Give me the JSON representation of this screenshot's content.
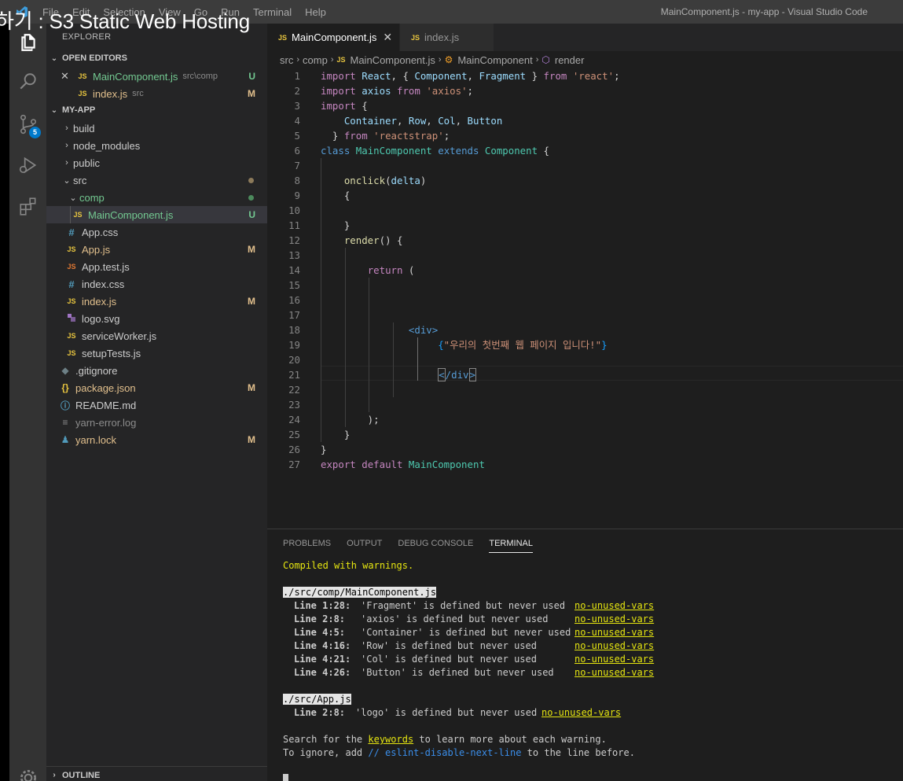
{
  "overlay_caption": "하기 : S3 Static Web Hosting",
  "titlebar": {
    "menu": [
      "File",
      "Edit",
      "Selection",
      "View",
      "Go",
      "Run",
      "Terminal",
      "Help"
    ],
    "window_title": "MainComponent.js - my-app - Visual Studio Code"
  },
  "activitybar": {
    "items": [
      "files-icon",
      "search-icon",
      "source-control-icon",
      "run-debug-icon",
      "extensions-icon",
      "accounts-icon"
    ],
    "source_control_badge": "5"
  },
  "sidebar": {
    "title": "EXPLORER",
    "open_editors_header": "OPEN EDITORS",
    "open_editors": [
      {
        "icon": "JS",
        "name": "MainComponent.js",
        "desc": "src\\comp",
        "status": "U"
      },
      {
        "icon": "JS",
        "name": "index.js",
        "desc": "src",
        "status": "M"
      }
    ],
    "project_header": "MY-APP",
    "tree": [
      {
        "name": "build",
        "type": "folder"
      },
      {
        "name": "node_modules",
        "type": "folder"
      },
      {
        "name": "public",
        "type": "folder"
      },
      {
        "name": "src",
        "type": "folder-open"
      },
      {
        "name": "comp",
        "type": "folder-open"
      },
      {
        "name": "MainComponent.js",
        "icon": "JS",
        "status": "U"
      },
      {
        "name": "App.css",
        "icon": "#"
      },
      {
        "name": "App.js",
        "icon": "JS",
        "status": "M"
      },
      {
        "name": "App.test.js",
        "icon": "JS"
      },
      {
        "name": "index.css",
        "icon": "#"
      },
      {
        "name": "index.js",
        "icon": "JS",
        "status": "M"
      },
      {
        "name": "logo.svg",
        "icon": "svg"
      },
      {
        "name": "serviceWorker.js",
        "icon": "JS"
      },
      {
        "name": "setupTests.js",
        "icon": "JS"
      },
      {
        "name": ".gitignore",
        "icon": "git"
      },
      {
        "name": "package.json",
        "icon": "{}",
        "status": "M"
      },
      {
        "name": "README.md",
        "icon": "i"
      },
      {
        "name": "yarn-error.log",
        "icon": "log"
      },
      {
        "name": "yarn.lock",
        "icon": "yarn",
        "status": "M"
      }
    ],
    "outline_header": "OUTLINE"
  },
  "tabs": [
    {
      "icon": "JS",
      "label": "MainComponent.js",
      "active": true
    },
    {
      "icon": "JS",
      "label": "index.js",
      "active": false
    }
  ],
  "breadcrumb": [
    "src",
    "comp",
    "MainComponent.js",
    "MainComponent",
    "render"
  ],
  "editor": {
    "line_numbers": [
      "1",
      "2",
      "3",
      "4",
      "5",
      "6",
      "7",
      "8",
      "9",
      "10",
      "11",
      "12",
      "13",
      "14",
      "15",
      "16",
      "17",
      "18",
      "19",
      "20",
      "21",
      "22",
      "23",
      "24",
      "25",
      "26",
      "27"
    ],
    "active_line": 21
  },
  "panel": {
    "tabs": [
      "PROBLEMS",
      "OUTPUT",
      "DEBUG CONSOLE",
      "TERMINAL"
    ],
    "active_tab": "TERMINAL",
    "compiled": "Compiled with warnings.",
    "file1": "./src/comp/MainComponent.js",
    "warnings1": [
      {
        "loc": "Line 1:28:",
        "msg": "'Fragment' is defined but never used",
        "rule": "no-unused-vars"
      },
      {
        "loc": "Line 2:8:",
        "msg": "'axios' is defined but never used",
        "rule": "no-unused-vars"
      },
      {
        "loc": "Line 4:5:",
        "msg": "'Container' is defined but never used",
        "rule": "no-unused-vars"
      },
      {
        "loc": "Line 4:16:",
        "msg": "'Row' is defined but never used",
        "rule": "no-unused-vars"
      },
      {
        "loc": "Line 4:21:",
        "msg": "'Col' is defined but never used",
        "rule": "no-unused-vars"
      },
      {
        "loc": "Line 4:26:",
        "msg": "'Button' is defined but never used",
        "rule": "no-unused-vars"
      }
    ],
    "file2": "./src/App.js",
    "warnings2": [
      {
        "loc": "Line 2:8:",
        "msg": "'logo' is defined but never used",
        "rule": "no-unused-vars"
      }
    ],
    "search_prefix": "Search for the ",
    "search_link": "keywords",
    "search_suffix": " to learn more about each warning.",
    "ignore_prefix": "To ignore, add ",
    "ignore_code": "// eslint-disable-next-line",
    "ignore_suffix": " to the line before."
  }
}
